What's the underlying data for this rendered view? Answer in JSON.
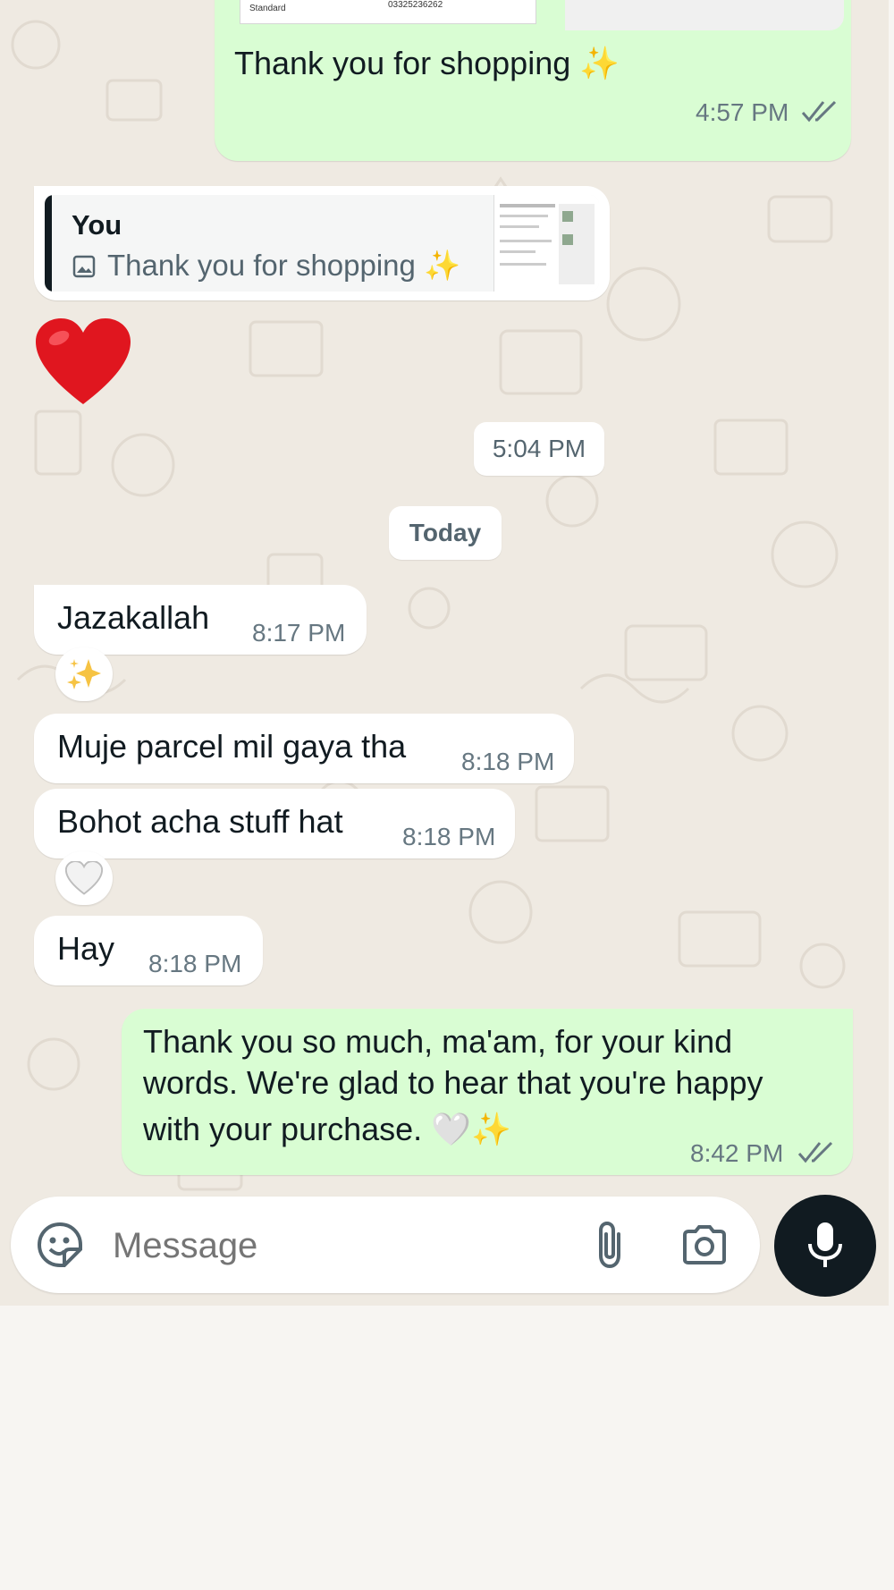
{
  "messages": {
    "m1": {
      "text": "Thank you for shopping ✨",
      "time": "4:57 PM",
      "doc_label": "Standard",
      "doc_phone": "03325236262"
    },
    "reply": {
      "quoted_author": "You",
      "quoted_text": "Thank you for shopping ✨",
      "emoji": "❤️"
    },
    "time_pill": "5:04 PM",
    "date_divider": "Today",
    "m2": {
      "text": "Jazakallah",
      "time": "8:17 PM",
      "reaction": "✨"
    },
    "m3": {
      "text": "Muje parcel mil gaya tha",
      "time": "8:18 PM"
    },
    "m4": {
      "text": "Bohot acha stuff hat",
      "time": "8:18 PM",
      "reaction": "🤍"
    },
    "m5": {
      "text": "Hay",
      "time": "8:18 PM"
    },
    "m6": {
      "line1": "Thank you so much, ma'am, for your kind",
      "line2": "words. We're glad to hear that you're happy",
      "line3": "with your purchase. 🤍✨",
      "time": "8:42 PM"
    }
  },
  "composer": {
    "placeholder": "Message",
    "icons": [
      "sticker-icon",
      "attach-icon",
      "camera-icon",
      "mic-icon"
    ]
  },
  "colors": {
    "outgoing": "#d9fdd3",
    "incoming": "#ffffff",
    "wallpaper": "#efeae2",
    "read_ticks": "#667781"
  }
}
